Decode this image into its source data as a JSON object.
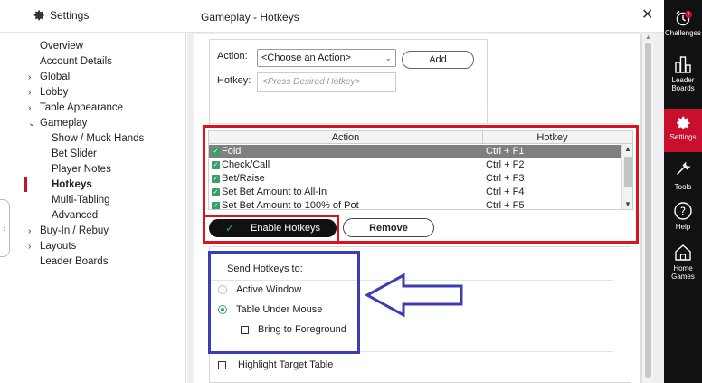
{
  "header": {
    "settings_label": "Settings",
    "page_title": "Gameplay - Hotkeys",
    "close_glyph": "✕"
  },
  "nav": {
    "items": [
      {
        "label": "Overview",
        "caret": ""
      },
      {
        "label": "Account Details",
        "caret": ""
      },
      {
        "label": "Global",
        "caret": "›"
      },
      {
        "label": "Lobby",
        "caret": "›"
      },
      {
        "label": "Table Appearance",
        "caret": "›"
      },
      {
        "label": "Gameplay",
        "caret": "⌄"
      },
      {
        "label": "Show / Muck Hands",
        "caret": ""
      },
      {
        "label": "Bet Slider",
        "caret": ""
      },
      {
        "label": "Player Notes",
        "caret": ""
      },
      {
        "label": "Hotkeys",
        "caret": ""
      },
      {
        "label": "Multi-Tabling",
        "caret": ""
      },
      {
        "label": "Advanced",
        "caret": ""
      },
      {
        "label": "Buy-In / Rebuy",
        "caret": "›"
      },
      {
        "label": "Layouts",
        "caret": "›"
      },
      {
        "label": "Leader Boards",
        "caret": ""
      }
    ],
    "active": "Hotkeys",
    "collapse_glyph": "›"
  },
  "action_form": {
    "action_label": "Action:",
    "action_value": "<Choose an Action>",
    "add_label": "Add",
    "hotkey_label": "Hotkey:",
    "hotkey_placeholder": "<Press Desired Hotkey>"
  },
  "table": {
    "headers": [
      "Action",
      "Hotkey"
    ],
    "rows": [
      {
        "action": "Fold",
        "hotkey": "Ctrl + F1",
        "selected": true
      },
      {
        "action": "Check/Call",
        "hotkey": "Ctrl + F2",
        "selected": false
      },
      {
        "action": "Bet/Raise",
        "hotkey": "Ctrl + F3",
        "selected": false
      },
      {
        "action": "Set Bet Amount to All-In",
        "hotkey": "Ctrl + F4",
        "selected": false
      },
      {
        "action": "Set Bet Amount to 100% of Pot",
        "hotkey": "Ctrl + F5",
        "selected": false
      }
    ]
  },
  "buttons": {
    "enable_hotkeys": "Enable Hotkeys",
    "remove": "Remove"
  },
  "send": {
    "title": "Send Hotkeys to:",
    "active_window": "Active Window",
    "table_under_mouse": "Table Under Mouse",
    "bring_to_foreground": "Bring to Foreground",
    "highlight_target_table": "Highlight Target Table",
    "selected": "Table Under Mouse"
  },
  "rail": {
    "items": [
      {
        "label": "Challenges",
        "icon": "alarm-clock-icon"
      },
      {
        "label": "Leader Boards",
        "icon": "leaderboard-icon"
      },
      {
        "label": "Settings",
        "icon": "gear-icon"
      },
      {
        "label": "Tools",
        "icon": "wrench-icon"
      },
      {
        "label": "Help",
        "icon": "help-icon"
      },
      {
        "label": "Home Games",
        "icon": "home-icon"
      }
    ],
    "badge": "!"
  },
  "colors": {
    "accent_red": "#c8102e",
    "check_green": "#3a9e6b",
    "annotation_red": "#d9141f",
    "annotation_blue": "#3c3cb4"
  }
}
